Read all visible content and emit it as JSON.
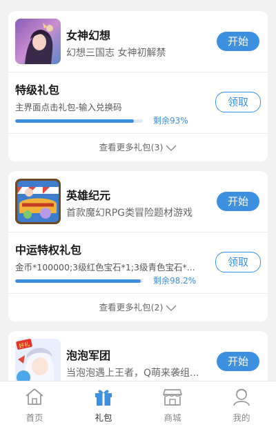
{
  "cards": [
    {
      "game": {
        "name": "女神幻想",
        "desc": "幻想三国志 女神初解禁",
        "start_label": "开始"
      },
      "gift": {
        "title": "特级礼包",
        "desc": "主界面点击礼包-输入兑换码",
        "remain_text": "剩余93%",
        "remain_fraction": 0.93,
        "claim_label": "领取"
      },
      "more_text": "查看更多礼包(3)"
    },
    {
      "game": {
        "name": "英雄纪元",
        "desc": "首款魔幻RPG类冒险题材游戏",
        "start_label": "开始"
      },
      "gift": {
        "title": "中运特权礼包",
        "desc": "金币*100000;3级红色宝石*1;3级青色宝石*...",
        "remain_text": "剩余98.2%",
        "remain_fraction": 0.982,
        "claim_label": "领取"
      },
      "more_text": "查看更多礼包(2)"
    },
    {
      "game": {
        "name": "泡泡军团",
        "desc": "当泡泡遇上王者，Q萌来袭组...",
        "start_label": "开始",
        "icon_badge": "好礼"
      }
    }
  ],
  "tabbar": {
    "items": [
      {
        "label": "首页",
        "icon": "home-icon"
      },
      {
        "label": "礼包",
        "icon": "gift-icon",
        "active": true
      },
      {
        "label": "商城",
        "icon": "store-icon"
      },
      {
        "label": "我的",
        "icon": "profile-icon"
      }
    ]
  },
  "colors": {
    "accent": "#3d8fe0",
    "background": "#f2f2f2"
  }
}
